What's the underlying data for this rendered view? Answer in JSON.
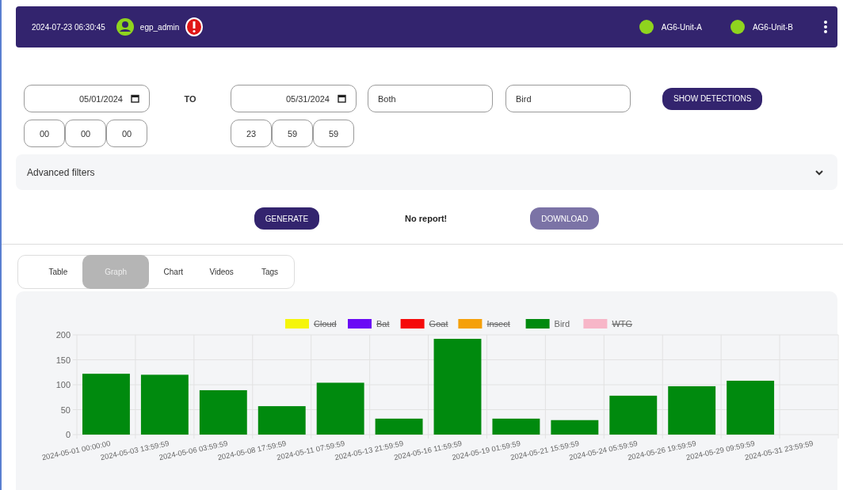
{
  "header": {
    "datetime": "2024-07-23 06:30:45",
    "user": "egp_admin",
    "alert": true,
    "units": [
      {
        "name": "AG6-Unit-A",
        "color": "#8fd41e"
      },
      {
        "name": "AG6-Unit-B",
        "color": "#8fd41e"
      }
    ]
  },
  "filters": {
    "from_date": "05/01/2024",
    "from_time": [
      "00",
      "00",
      "00"
    ],
    "to_label": "TO",
    "to_date": "05/31/2024",
    "to_time": [
      "23",
      "59",
      "59"
    ],
    "type": "Both",
    "species": "Bird",
    "show_button": "SHOW DETECTIONS"
  },
  "advanced_filters": {
    "label": "Advanced filters",
    "expanded": false
  },
  "report": {
    "generate": "GENERATE",
    "status": "No report!",
    "download": "DOWNLOAD",
    "download_disabled": true
  },
  "tabs": [
    {
      "label": "Table",
      "selected": false
    },
    {
      "label": "Graph",
      "selected": true
    },
    {
      "label": "Chart",
      "selected": false
    },
    {
      "label": "Videos",
      "selected": false
    },
    {
      "label": "Tags",
      "selected": false
    }
  ],
  "graph": {
    "legend": [
      {
        "name": "Cloud",
        "color": "#f5f50a",
        "hidden": true
      },
      {
        "name": "Bat",
        "color": "#6a0af5",
        "hidden": true
      },
      {
        "name": "Goat",
        "color": "#f50a0a",
        "hidden": true
      },
      {
        "name": "Insect",
        "color": "#f5a00a",
        "hidden": true
      },
      {
        "kind": "series",
        "hidden": false
      },
      {
        "name": "WTG",
        "color": "#f7b6c8",
        "hidden": true
      }
    ],
    "chart_data": {
      "type": "bar",
      "grid": true,
      "ylim": [
        0,
        200
      ],
      "yticks": [
        0,
        50,
        100,
        150,
        200
      ],
      "categories": [
        "2024-05-01 00:00:00",
        "2024-05-03 13:59:59",
        "2024-05-06 03:59:59",
        "2024-05-08 17:59:59",
        "2024-05-11 07:59:59",
        "2024-05-13 21:59:59",
        "2024-05-16 11:59:59",
        "2024-05-19 01:59:59",
        "2024-05-21 15:59:59",
        "2024-05-24 05:59:59",
        "2024-05-26 19:59:59",
        "2024-05-29 09:59:59",
        "2024-05-31 23:59:59"
      ],
      "series": [
        {
          "name": "Bird",
          "color": "#008a0e",
          "values": [
            122,
            120,
            89,
            57,
            104,
            32,
            192,
            32,
            29,
            78,
            97,
            108,
            null
          ]
        }
      ]
    }
  }
}
